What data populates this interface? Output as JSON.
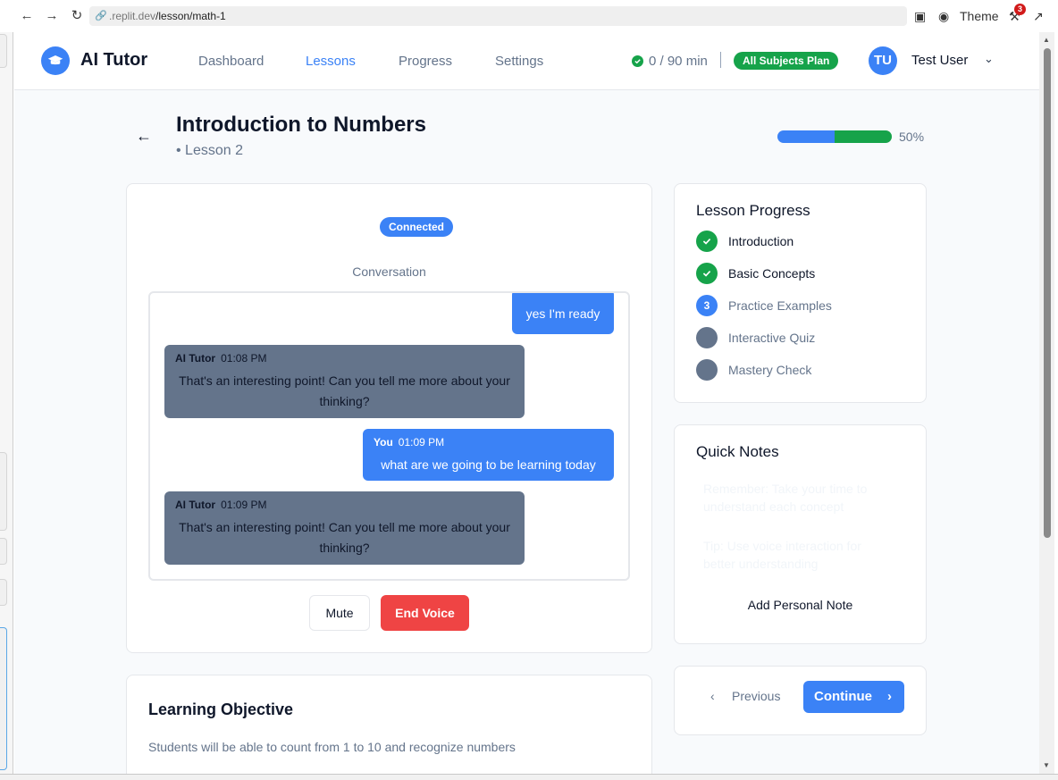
{
  "browser": {
    "url_prefix": ".replit.dev",
    "url_path": "/lesson/math-1",
    "theme_label": "Theme",
    "badge_count": "3"
  },
  "header": {
    "brand": "AI Tutor",
    "nav": [
      "Dashboard",
      "Lessons",
      "Progress",
      "Settings"
    ],
    "active_nav": "Lessons",
    "usage": "0 / 90 min",
    "plan": "All Subjects Plan",
    "avatar_initials": "TU",
    "user_name": "Test User"
  },
  "lesson": {
    "title": "Introduction to Numbers",
    "subtitle": "• Lesson 2",
    "progress_percent": 50,
    "progress_label": "50%"
  },
  "conversation": {
    "status": "Connected",
    "label": "Conversation",
    "messages": [
      {
        "role": "user",
        "author": "",
        "time": "",
        "text": "yes I'm ready"
      },
      {
        "role": "tutor",
        "author": "AI Tutor",
        "time": "01:08 PM",
        "text": "That's an interesting point! Can you tell me more about your thinking?"
      },
      {
        "role": "user",
        "author": "You",
        "time": "01:09 PM",
        "text": "what are we going to be learning today"
      },
      {
        "role": "tutor",
        "author": "AI Tutor",
        "time": "01:09 PM",
        "text": "That's an interesting point! Can you tell me more about your thinking?"
      }
    ],
    "mute_label": "Mute",
    "end_label": "End Voice"
  },
  "progress_panel": {
    "title": "Lesson Progress",
    "steps": [
      {
        "label": "Introduction",
        "state": "done",
        "marker": ""
      },
      {
        "label": "Basic Concepts",
        "state": "done",
        "marker": ""
      },
      {
        "label": "Practice Examples",
        "state": "current",
        "marker": "3"
      },
      {
        "label": "Interactive Quiz",
        "state": "todo",
        "marker": ""
      },
      {
        "label": "Mastery Check",
        "state": "todo",
        "marker": ""
      }
    ]
  },
  "notes": {
    "title": "Quick Notes",
    "items": [
      "Remember: Take your time to understand each concept",
      "Tip: Use voice interaction for better understanding"
    ],
    "add_label": "Add Personal Note"
  },
  "pager": {
    "previous": "Previous",
    "continue": "Continue"
  },
  "objective": {
    "title": "Learning Objective",
    "text": "Students will be able to count from 1 to 10 and recognize numbers"
  },
  "colors": {
    "primary": "#3b82f6",
    "success": "#16a34a",
    "danger": "#ef4444",
    "muted": "#64748b"
  }
}
